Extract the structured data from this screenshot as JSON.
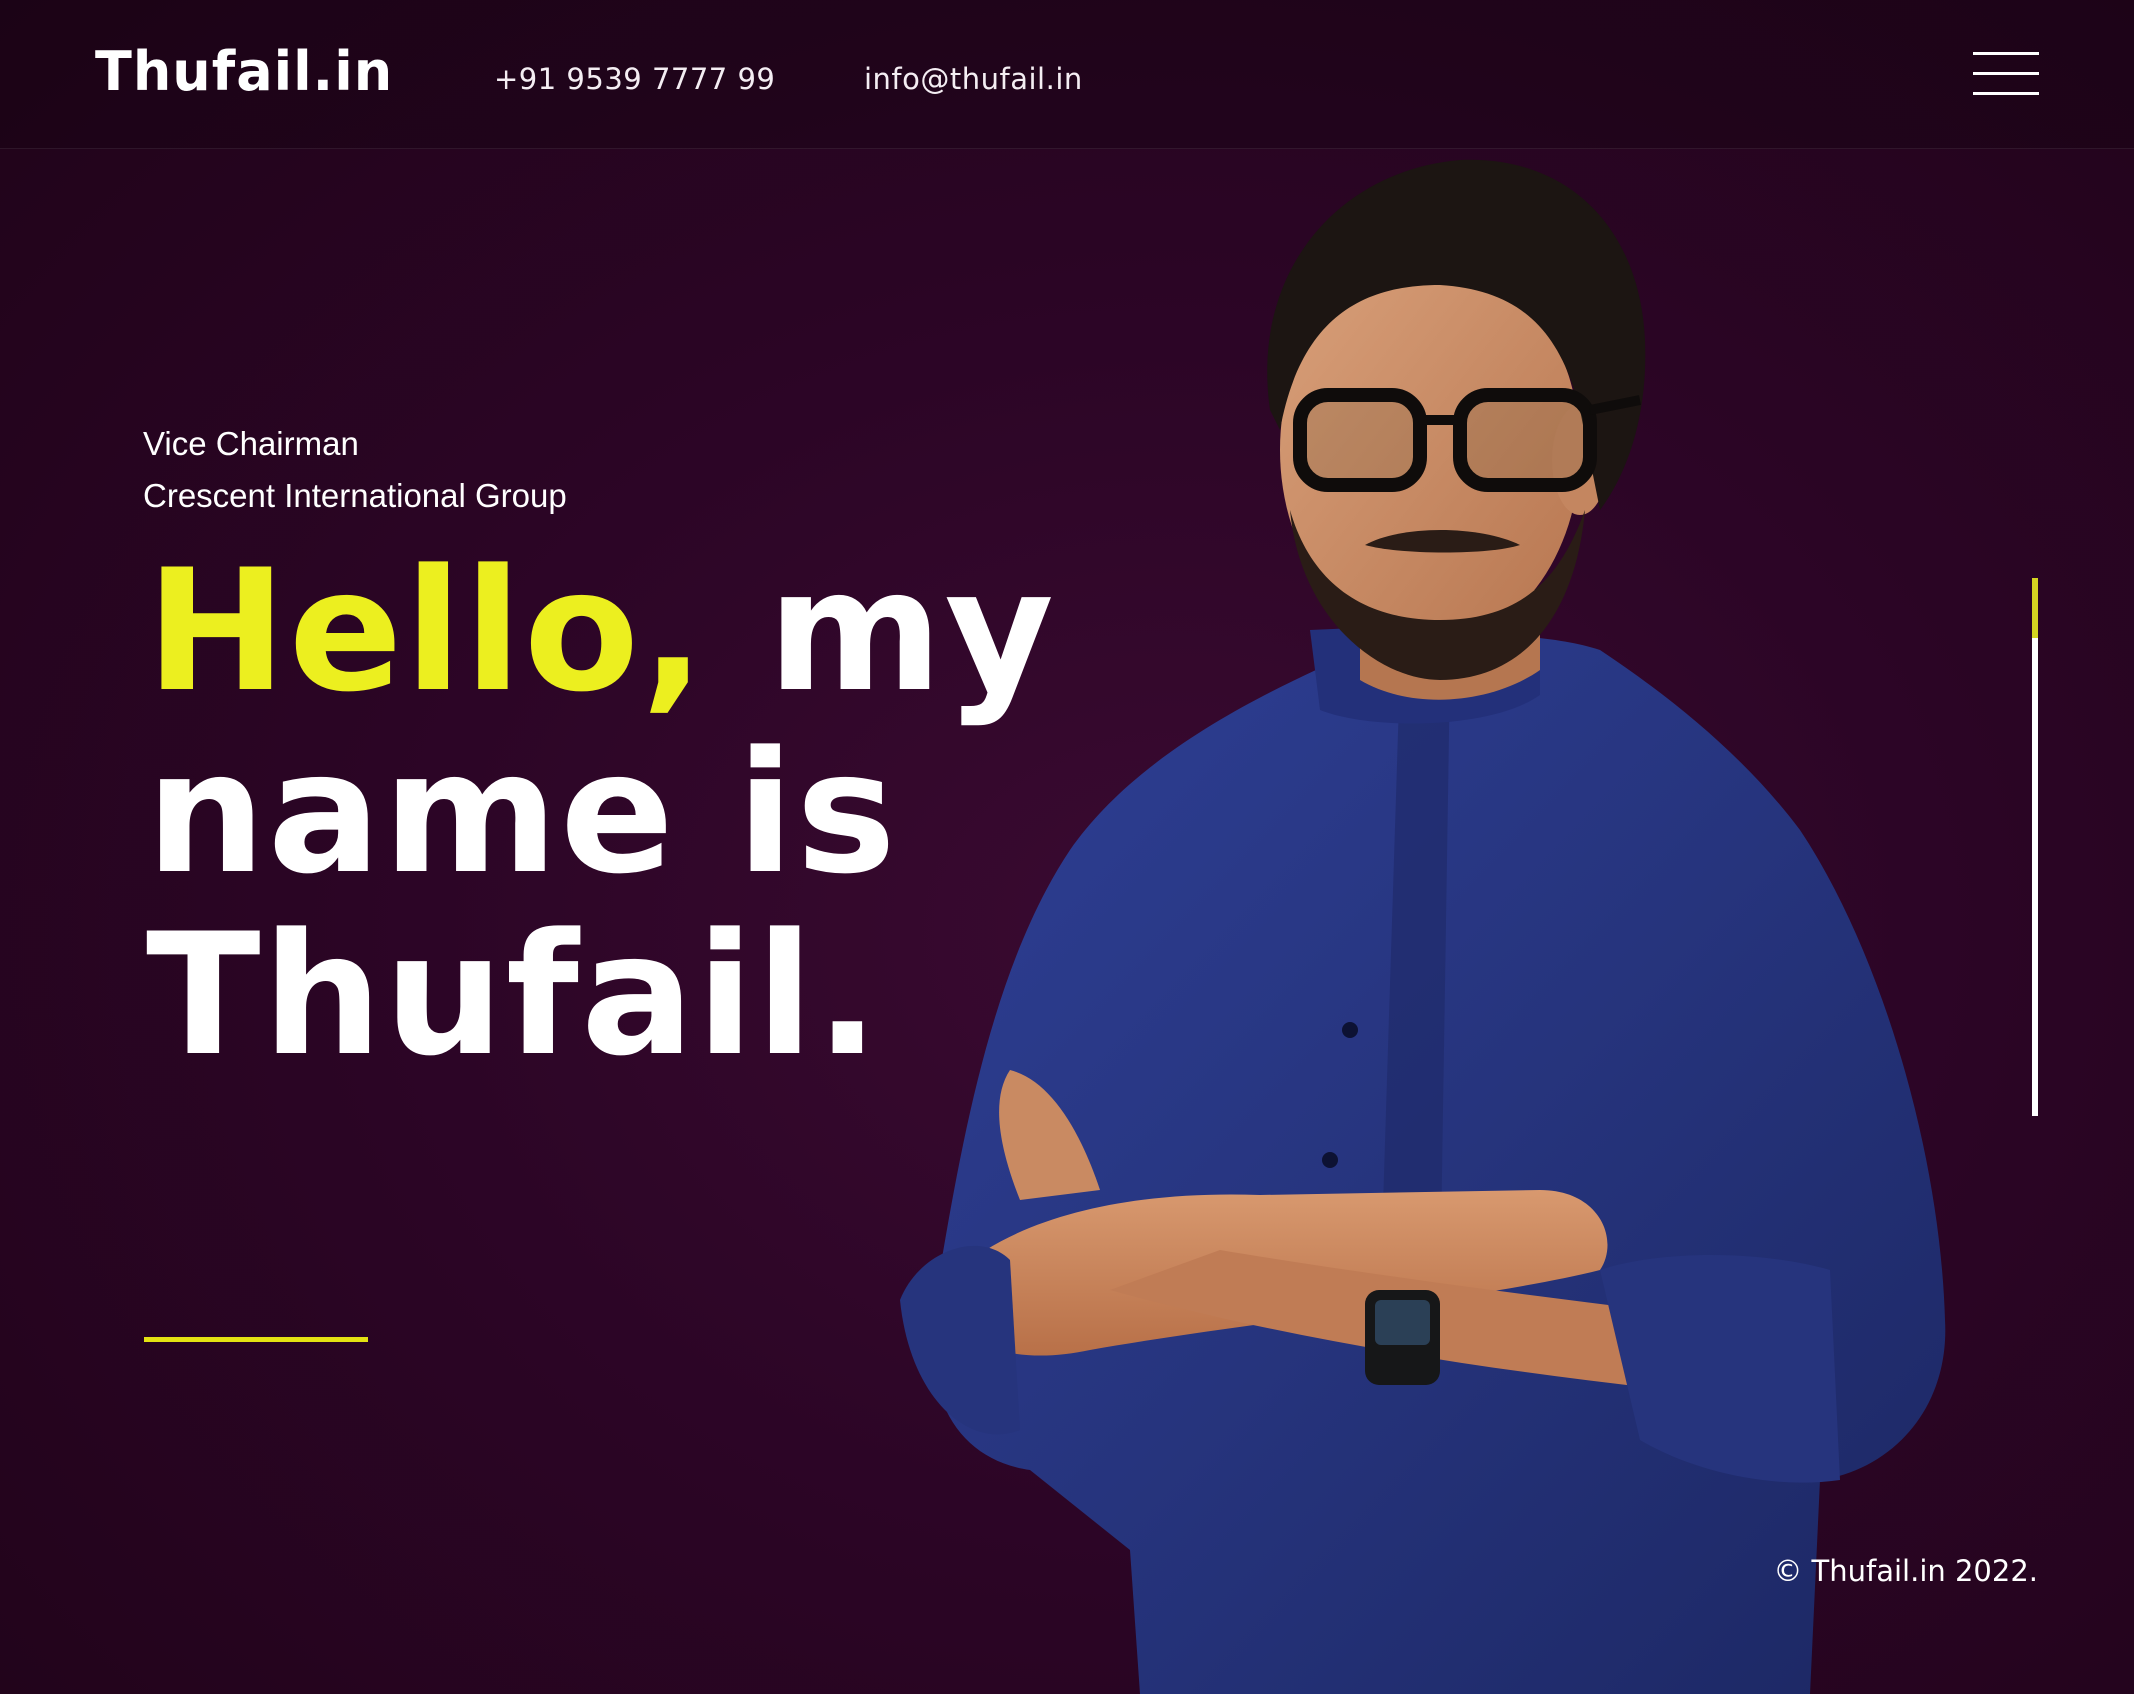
{
  "header": {
    "logo": "Thufail.in",
    "phone": "+91 9539 7777 99",
    "email": "info@thufail.in",
    "menu_icon": "hamburger-menu-icon"
  },
  "hero": {
    "role": "Vice Chairman",
    "organization": "Crescent International Group",
    "headline_highlight": "Hello,",
    "headline_line1_rest": "my",
    "headline_line2": "name is",
    "headline_line3": "Thufail."
  },
  "slider": {
    "active_index": 1,
    "total_slides": 1
  },
  "footer": {
    "copyright": "© Thufail.in 2022."
  },
  "colors": {
    "background": "#2c0526",
    "accent": "#ecef1f",
    "text": "#ffffff",
    "shirt": "#2b3a88"
  }
}
